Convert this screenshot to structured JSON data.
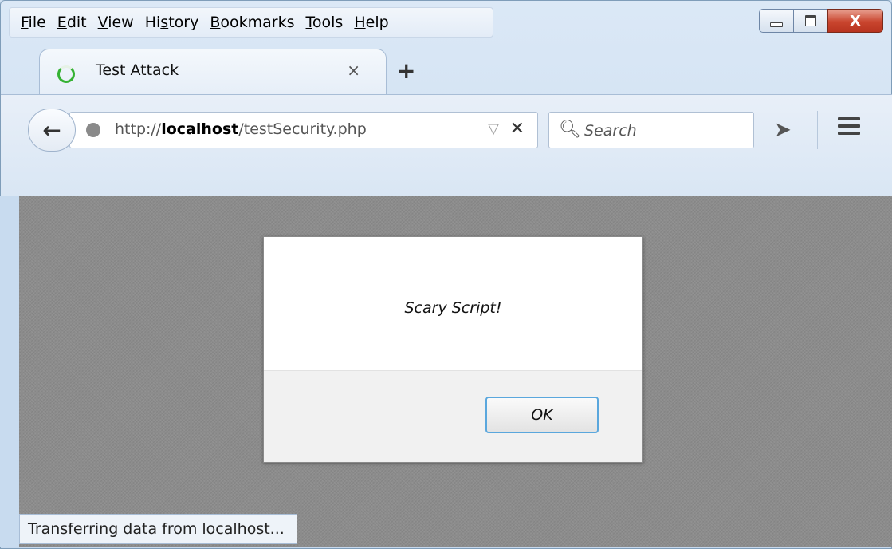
{
  "menubar": {
    "items": [
      "File",
      "Edit",
      "View",
      "History",
      "Bookmarks",
      "Tools",
      "Help"
    ]
  },
  "tab": {
    "title": "Test Attack",
    "close_glyph": "×",
    "new_tab_glyph": "+"
  },
  "toolbar": {
    "back_glyph": "←",
    "url_prefix": "http://",
    "url_host": "localhost",
    "url_path": "/testSecurity.php",
    "dropdown_glyph": "▽",
    "stop_glyph": "✕",
    "search_placeholder": "Search"
  },
  "window_controls": {
    "close_glyph": "X"
  },
  "dialog": {
    "message": "Scary Script!",
    "ok_label": "OK"
  },
  "status": {
    "text": "Transferring data from localhost..."
  }
}
